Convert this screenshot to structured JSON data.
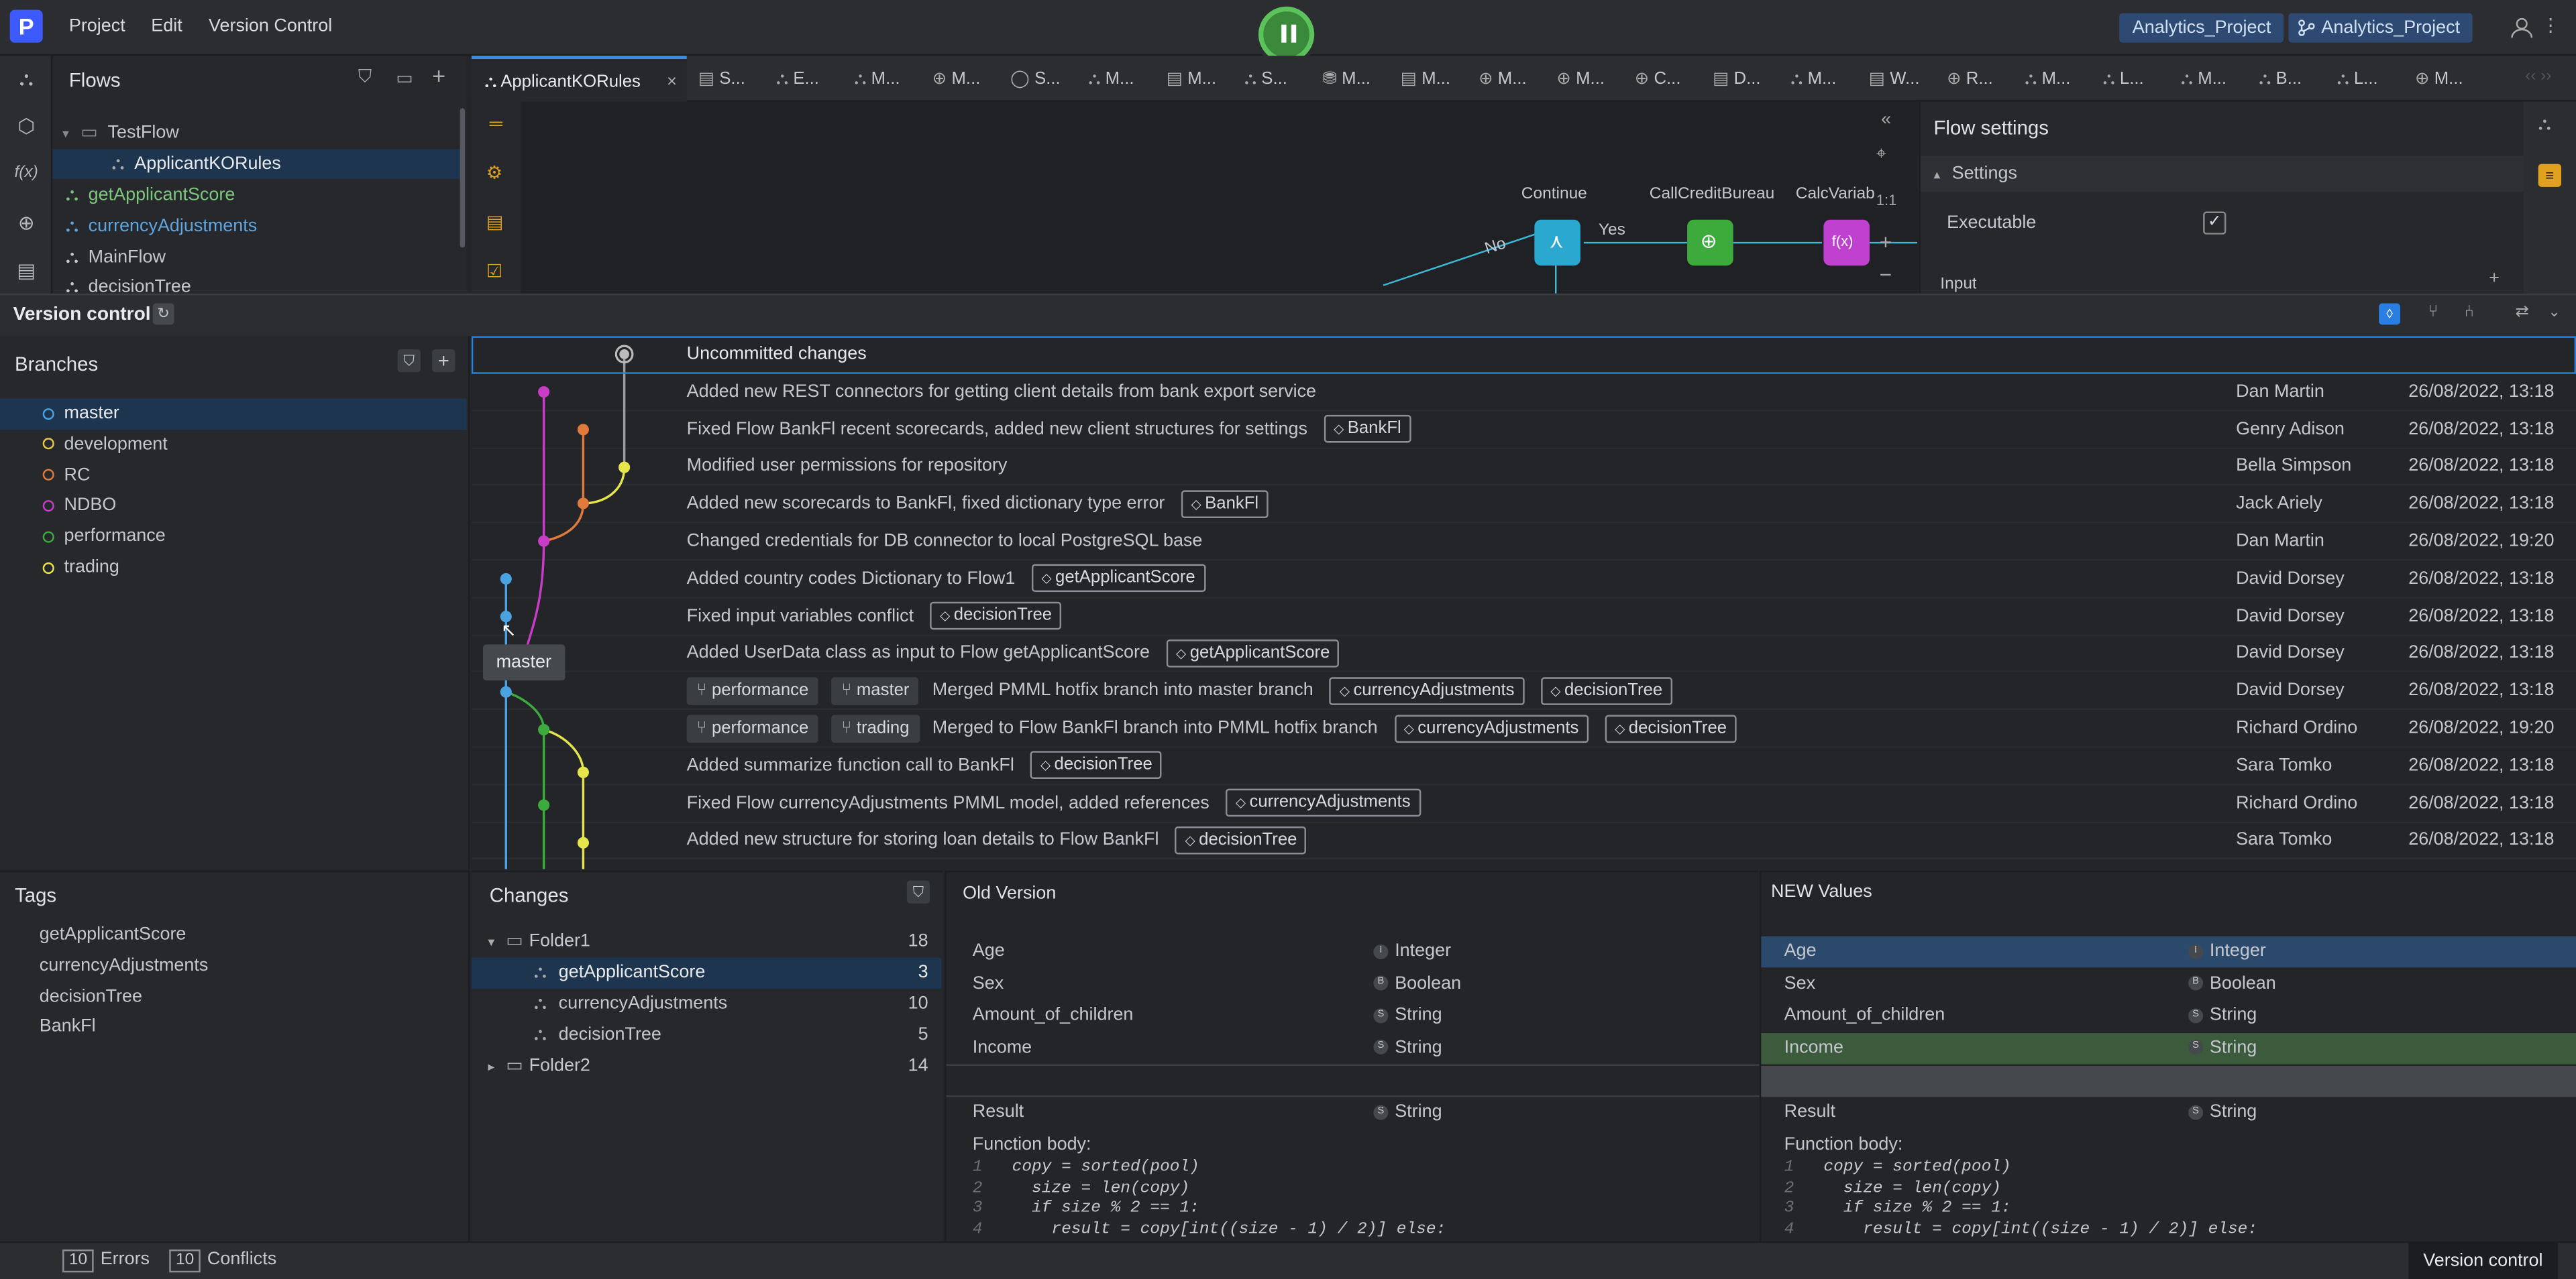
{
  "app": {
    "logo": "P",
    "menu": [
      "Project",
      "Edit",
      "Version Control"
    ],
    "project_tab_1": "Analytics_Project",
    "project_tab_2": "Analytics_Project"
  },
  "flows": {
    "title": "Flows",
    "items": [
      "TestFlow",
      "ApplicantKORules",
      "getApplicantScore",
      "currencyAdjustments",
      "MainFlow",
      "decisionTree"
    ]
  },
  "tabs": {
    "active": "ApplicantKORules",
    "others": [
      "S...",
      "E...",
      "M...",
      "M...",
      "S...",
      "M...",
      "M...",
      "S...",
      "M...",
      "M...",
      "M...",
      "M...",
      "C...",
      "D...",
      "M...",
      "W...",
      "R...",
      "M...",
      "L...",
      "M...",
      "B...",
      "L...",
      "M..."
    ]
  },
  "canvas": {
    "labels": {
      "no": "No",
      "yes": "Yes",
      "continue": "Continue",
      "call_credit": "CallCreditBureau",
      "calc": "CalcVariab",
      "fx": "f(x)",
      "one": "1:1"
    }
  },
  "flow_settings": {
    "title": "Flow settings",
    "section": "Settings",
    "executable_label": "Executable",
    "executable": true,
    "input_label": "Input"
  },
  "version_control": {
    "title": "Version control"
  },
  "branches": {
    "title": "Branches",
    "items": [
      {
        "name": "master",
        "color": "#4aa3df"
      },
      {
        "name": "development",
        "color": "#e6c84a"
      },
      {
        "name": "RC",
        "color": "#e07b3c"
      },
      {
        "name": "NDBO",
        "color": "#c83cc8"
      },
      {
        "name": "performance",
        "color": "#3cab3c"
      },
      {
        "name": "trading",
        "color": "#e6e64a"
      }
    ]
  },
  "commits": [
    {
      "msg": "Uncommitted changes",
      "author": "",
      "date": "",
      "tags": [],
      "branches": []
    },
    {
      "msg": "Added new REST connectors for getting client details from bank export service",
      "author": "Dan Martin",
      "date": "26/08/2022, 13:18",
      "tags": [],
      "branches": []
    },
    {
      "msg": "Fixed Flow BankFl recent scorecards, added new client structures for settings",
      "author": "Genry Adison",
      "date": "26/08/2022, 13:18",
      "tags": [
        "BankFl"
      ],
      "branches": []
    },
    {
      "msg": "Modified user permissions for repository",
      "author": "Bella Simpson",
      "date": "26/08/2022, 13:18",
      "tags": [],
      "branches": []
    },
    {
      "msg": "Added new scorecards to BankFl, fixed dictionary type error",
      "author": "Jack Ariely",
      "date": "26/08/2022, 13:18",
      "tags": [
        "BankFl"
      ],
      "branches": []
    },
    {
      "msg": "Changed credentials for DB connector to local PostgreSQL base",
      "author": "Dan Martin",
      "date": "26/08/2022, 19:20",
      "tags": [],
      "branches": []
    },
    {
      "msg": "Added country codes Dictionary to Flow1",
      "author": "David Dorsey",
      "date": "26/08/2022, 13:18",
      "tags": [
        "getApplicantScore"
      ],
      "branches": []
    },
    {
      "msg": "Fixed input variables conflict",
      "author": "David Dorsey",
      "date": "26/08/2022, 13:18",
      "tags": [
        "decisionTree"
      ],
      "branches": []
    },
    {
      "msg": "Added UserData class as input to Flow getApplicantScore",
      "author": "David Dorsey",
      "date": "26/08/2022, 13:18",
      "tags": [
        "getApplicantScore"
      ],
      "branches": []
    },
    {
      "msg": "Merged PMML hotfix branch into master branch",
      "author": "David Dorsey",
      "date": "26/08/2022, 13:18",
      "tags": [
        "currencyAdjustments",
        "decisionTree"
      ],
      "branches": [
        "performance",
        "master"
      ]
    },
    {
      "msg": "Merged to Flow BankFl branch into PMML hotfix branch",
      "author": "Richard Ordino",
      "date": "26/08/2022, 19:20",
      "tags": [
        "currencyAdjustments",
        "decisionTree"
      ],
      "branches": [
        "performance",
        "trading"
      ]
    },
    {
      "msg": "Added summarize function call to BankFl",
      "author": "Sara Tomko",
      "date": "26/08/2022, 13:18",
      "tags": [
        "decisionTree"
      ],
      "branches": []
    },
    {
      "msg": "Fixed Flow currencyAdjustments PMML model, added references",
      "author": "Richard Ordino",
      "date": "26/08/2022, 13:18",
      "tags": [
        "currencyAdjustments"
      ],
      "branches": []
    },
    {
      "msg": "Added new structure for storing loan details to Flow BankFl",
      "author": "Sara Tomko",
      "date": "26/08/2022, 13:18",
      "tags": [
        "decisionTree"
      ],
      "branches": []
    }
  ],
  "tooltip": "master",
  "tags_panel": {
    "title": "Tags",
    "items": [
      "getApplicantScore",
      "currencyAdjustments",
      "decisionTree",
      "BankFl"
    ]
  },
  "changes": {
    "title": "Changes",
    "folder1": {
      "name": "Folder1",
      "count": "18"
    },
    "files": [
      {
        "name": "getApplicantScore",
        "count": "3"
      },
      {
        "name": "currencyAdjustments",
        "count": "10"
      },
      {
        "name": "decisionTree",
        "count": "5"
      }
    ],
    "folder2": {
      "name": "Folder2",
      "count": "14"
    }
  },
  "old_version": {
    "title": "Old Version",
    "rows": [
      {
        "name": "Age",
        "badge": "I",
        "type": "Integer"
      },
      {
        "name": "Sex",
        "badge": "B",
        "type": "Boolean"
      },
      {
        "name": "Amount_of_children",
        "badge": "S",
        "type": "String"
      },
      {
        "name": "Income",
        "badge": "S",
        "type": "String"
      }
    ],
    "result": {
      "name": "Result",
      "badge": "S",
      "type": "String"
    }
  },
  "new_version": {
    "title": "NEW Values",
    "rows": [
      {
        "name": "Age",
        "badge": "I",
        "type": "Integer"
      },
      {
        "name": "Sex",
        "badge": "B",
        "type": "Boolean"
      },
      {
        "name": "Amount_of_children",
        "badge": "S",
        "type": "String"
      },
      {
        "name": "Income",
        "badge": "S",
        "type": "String"
      }
    ],
    "result": {
      "name": "Result",
      "badge": "S",
      "type": "String"
    }
  },
  "function_body_label": "Function body:",
  "code_lines": [
    "copy = sorted(pool)",
    "  size = len(copy)",
    "  if size % 2 == 1:",
    "    result = copy[int((size - 1) / 2)] else:"
  ],
  "status": {
    "errors_count": "10",
    "errors_label": "Errors",
    "conflicts_count": "10",
    "conflicts_label": "Conflicts",
    "right_label": "Version control"
  }
}
